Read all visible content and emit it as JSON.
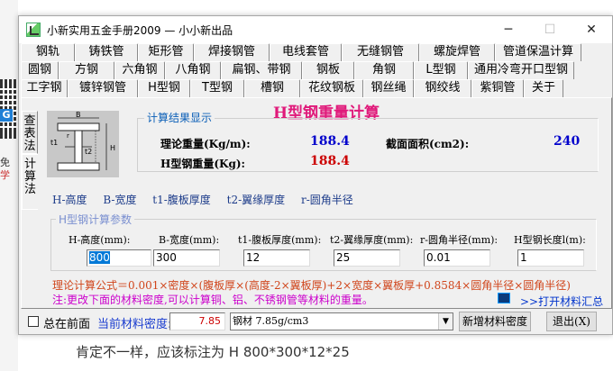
{
  "background": {
    "side_text_1": "免",
    "side_text_2": "学",
    "footer_text": "肯定不一样，应该标注为   H 800*300*12*25"
  },
  "window": {
    "title": "小新实用五金手册2009 — 小小新出品",
    "min_icon": "minimize-icon",
    "max_icon": "maximize-icon",
    "close_icon": "close-icon"
  },
  "tabs": {
    "row1": [
      "钢轨",
      "铸铁管",
      "矩形管",
      "焊接钢管",
      "电线套管",
      "无缝钢管",
      "螺旋焊管",
      "管道保温计算"
    ],
    "row2": [
      "圆钢",
      "方钢",
      "六角钢",
      "八角钢",
      "扁钢、带钢",
      "钢板",
      "角钢",
      "L型钢",
      "通用冷弯开口型钢"
    ],
    "row3": [
      "工字钢",
      "镀锌钢管",
      "H型钢",
      "T型钢",
      "槽钢",
      "花纹钢板",
      "钢丝绳",
      "钢绞线",
      "紫铜管",
      "关于"
    ],
    "active": "H型钢"
  },
  "side_tabs": {
    "lookup": "查表法",
    "calc": "计算法"
  },
  "heading": "H型钢重量计算",
  "diagram": {
    "label_B": "B",
    "label_H": "H",
    "label_t1": "t1",
    "label_t2": "t2",
    "label_r": "r"
  },
  "result": {
    "legend": "计算结果显示",
    "theory_weight_label": "理论重量(Kg/m):",
    "theory_weight_value": "188.4",
    "section_area_label": "截面面积(cm2):",
    "section_area_value": "240",
    "h_weight_label": "H型钢重量(Kg):",
    "h_weight_value": "188.4"
  },
  "legend_line": [
    "H-高度",
    "B-宽度",
    "t1-腹板厚度",
    "t2-翼缘厚度",
    "r-圆角半径"
  ],
  "params": {
    "legend": "H型钢计算参数",
    "fields": [
      {
        "label": "H-高度(mm):",
        "value": "800"
      },
      {
        "label": "B-宽度(mm):",
        "value": "300"
      },
      {
        "label": "t1-腹板厚度(mm):",
        "value": "12"
      },
      {
        "label": "t2-翼缘厚度(mm):",
        "value": "25"
      },
      {
        "label": "r-圆角半径(mm):",
        "value": "0.01"
      },
      {
        "label": "H型钢长度l(m):",
        "value": "1"
      }
    ]
  },
  "formula": {
    "label": "理论计算公式＝",
    "text": "0.001×密度×(腹板厚×(高度-2×翼板厚)+2×宽度×翼板厚+0.8584×圆角半径×圆角半径)"
  },
  "note": "注:更改下面的材料密度,可以计算铜、铝、不锈钢管等材料的重量。",
  "open_material": ">>打开材料汇总",
  "bottom": {
    "on_top_label": "总在前面",
    "current_density_label": "当前材料密度:",
    "density_value": "7.85",
    "material_selected": "钢材 7.85g/cm3",
    "new_density_button": "新增材料密度",
    "exit_button": "退出(X)"
  }
}
